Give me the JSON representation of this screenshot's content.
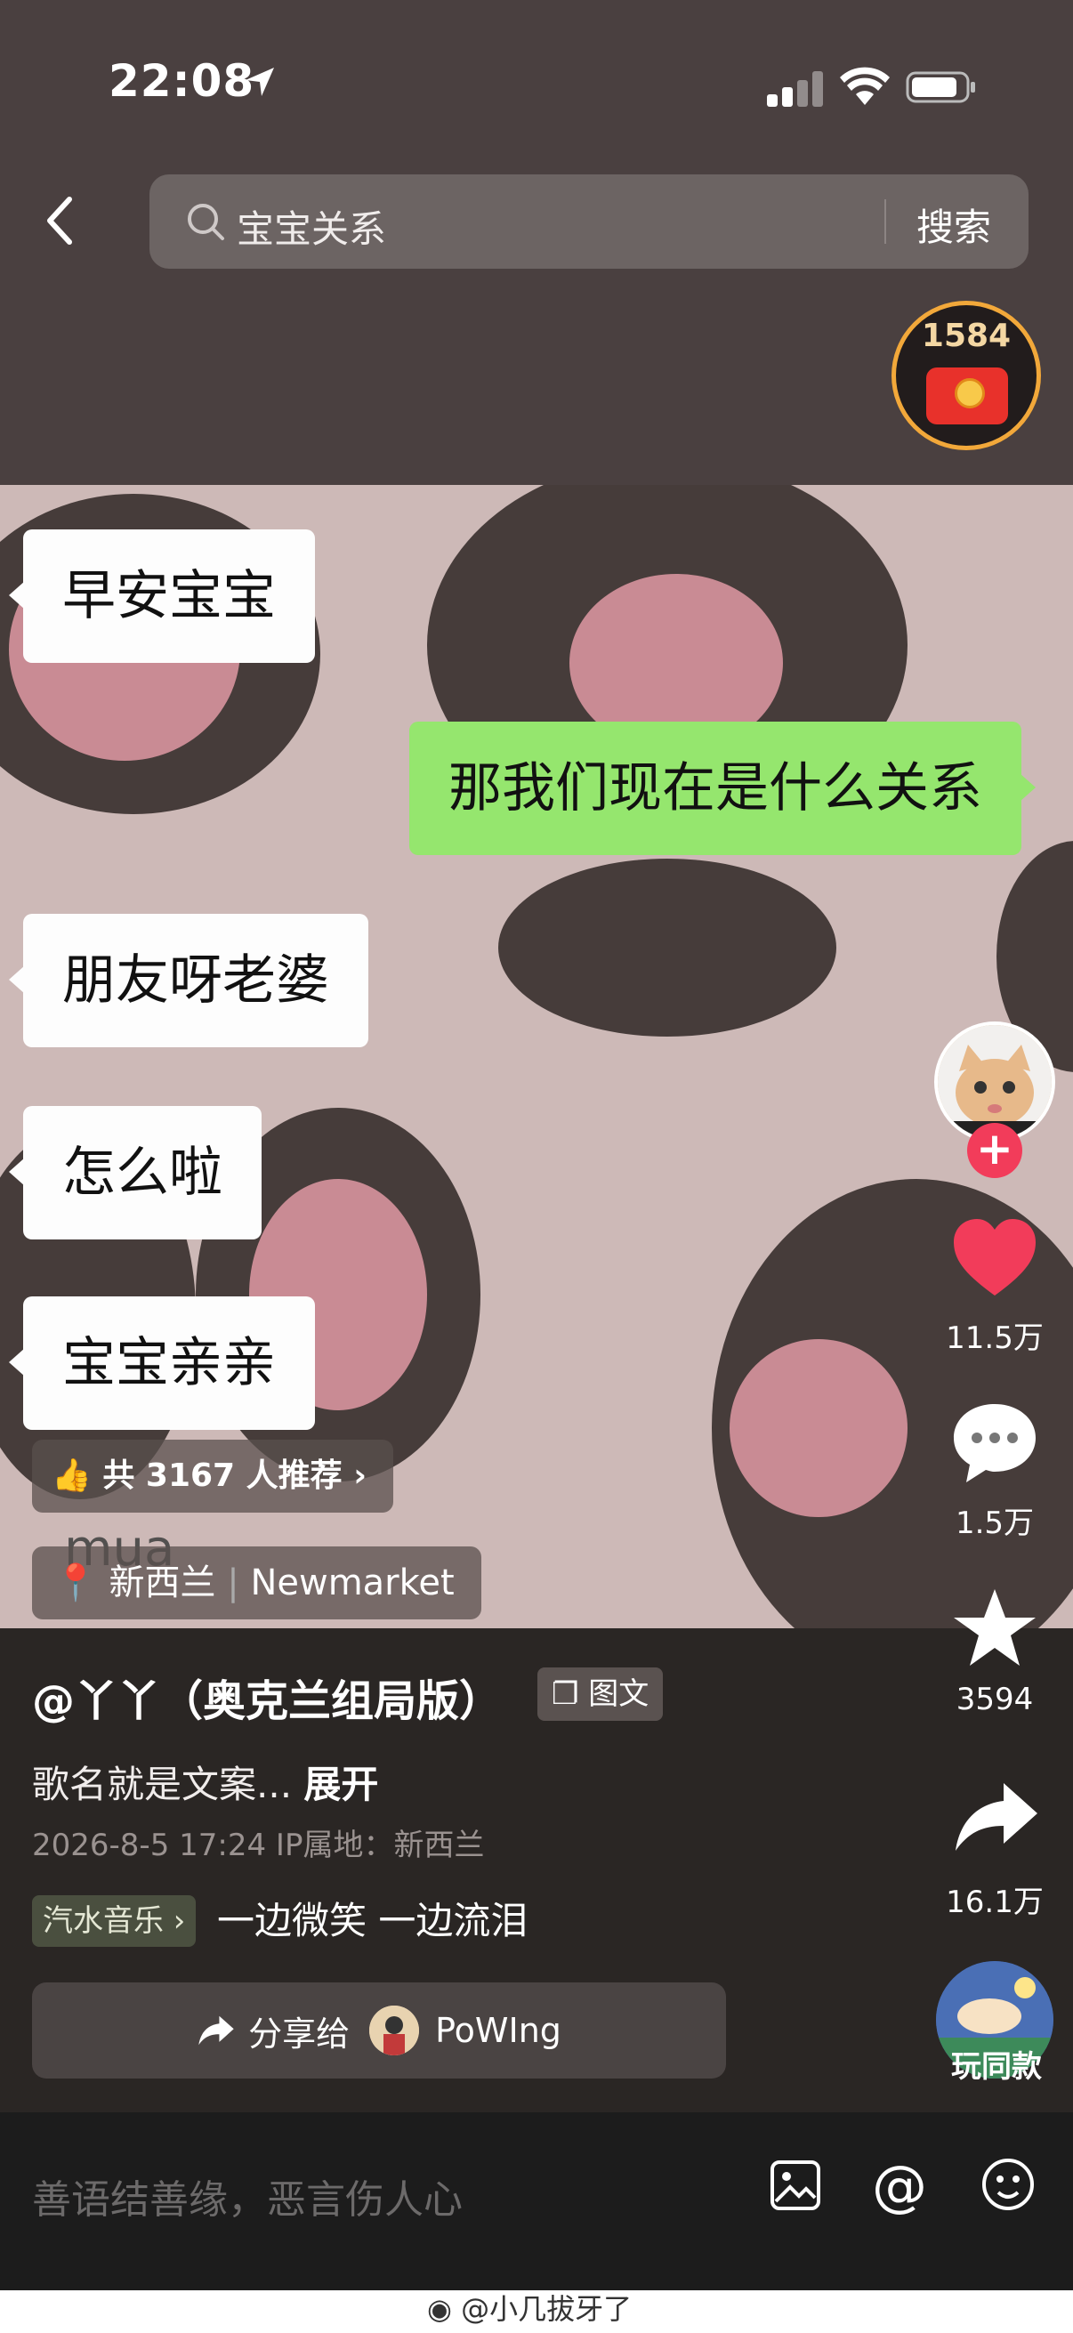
{
  "status_bar": {
    "time": "22:08"
  },
  "header": {
    "search_query": "宝宝关系",
    "search_button": "搜索",
    "coin_count": "1584"
  },
  "chat": {
    "messages": [
      {
        "text": "早安宝宝",
        "side": "left"
      },
      {
        "text": "那我们现在是什么关系",
        "side": "right"
      },
      {
        "text": "朋友呀老婆",
        "side": "left"
      },
      {
        "text": "怎么啦",
        "side": "left"
      },
      {
        "text": "宝宝亲亲",
        "side": "left"
      },
      {
        "text": "mua",
        "side": "left"
      }
    ]
  },
  "overlay": {
    "recommend": "共 3167 人推荐",
    "location_city": "新西兰",
    "location_place": "Newmarket"
  },
  "sidebar": {
    "likes": "11.5万",
    "comments": "1.5万",
    "favorites": "3594",
    "shares": "16.1万",
    "remix_label": "玩同款"
  },
  "post": {
    "author": "@丫丫（奥克兰组局版）",
    "type_badge": "图文",
    "description": "歌名就是文案...",
    "expand": "展开",
    "meta": "2026-8-5 17:24  IP属地：新西兰",
    "music_tag": "汽水音乐 ›",
    "music_text": "一边微笑 一边流泪",
    "share_label": "分享给",
    "share_user": "PoWIng"
  },
  "comment": {
    "placeholder": "善语结善缘，恶言伤人心"
  },
  "footer": {
    "watermark": "@小几拔牙了"
  }
}
